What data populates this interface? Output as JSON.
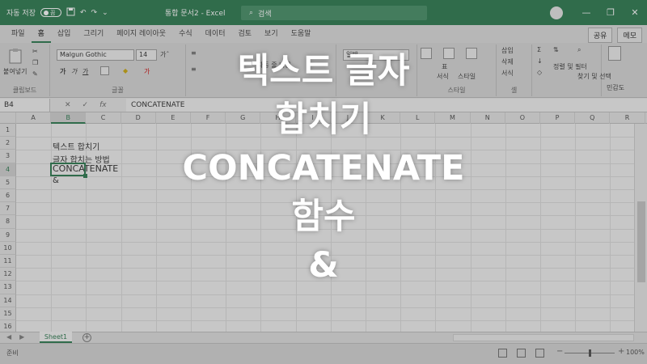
{
  "colors": {
    "accent": "#217346",
    "headline": "#ffffff"
  },
  "titlebar": {
    "autosave_label": "자동 저장",
    "autosave_state": "끔",
    "doc_title": "통합 문서2 - Excel",
    "search_placeholder": "검색",
    "icons": [
      "save-icon",
      "undo-icon",
      "redo-icon",
      "search-icon",
      "minimize-icon",
      "maximize-icon",
      "close-icon"
    ]
  },
  "ribbon_tabs": [
    "파일",
    "홈",
    "삽입",
    "그리기",
    "페이지 레이아웃",
    "수식",
    "데이터",
    "검토",
    "보기",
    "도움말"
  ],
  "active_tab": "홈",
  "share_label": "공유",
  "comment_label": "메모",
  "ribbon": {
    "clipboard": {
      "paste_label": "붙여넣기",
      "group_label": "클립보드"
    },
    "font": {
      "name": "Malgun Gothic",
      "size": "14",
      "bold": "가",
      "italic": "가",
      "underline": "가",
      "group_label": "글꼴"
    },
    "alignment": {
      "wrap_text": "자동 줄 바꿈"
    },
    "number": {
      "format": "일반"
    },
    "styles": {
      "table_label": "표",
      "format_label": "서식",
      "cell_style_label": "스타일",
      "group_label": "스타일"
    },
    "cells": {
      "insert_label": "삽입",
      "delete_label": "삭제",
      "format_label": "서식",
      "group_label": "셀"
    },
    "editing": {
      "sort_label": "정렬 및 필터",
      "find_label": "찾기 및 선택",
      "group_label": "편집"
    },
    "sensitivity": {
      "label": "민감도"
    }
  },
  "formula_bar": {
    "name_box": "B4",
    "cancel": "✕",
    "enter": "✓",
    "fx": "fx",
    "content": "CONCATENATE"
  },
  "columns": [
    "A",
    "B",
    "C",
    "D",
    "E",
    "F",
    "G",
    "H",
    "I",
    "J",
    "K",
    "L",
    "M",
    "N",
    "O",
    "P",
    "Q",
    "R"
  ],
  "selected_column": "B",
  "rows": [
    "1",
    "2",
    "3",
    "4",
    "5",
    "6",
    "7",
    "8",
    "9",
    "10",
    "11",
    "12",
    "13",
    "14",
    "15",
    "16"
  ],
  "selected_row": "4",
  "cells": [
    {
      "ref": "B2",
      "text": "텍스트 합치기"
    },
    {
      "ref": "B3",
      "text": "글자 합치는 방법"
    },
    {
      "ref": "B4",
      "text": "CONCATENATE"
    },
    {
      "ref": "B5",
      "text": "&"
    }
  ],
  "sheet_tabs": {
    "active": "Sheet1",
    "add": "+"
  },
  "status": {
    "ready": "준비",
    "zoom_percent": 100
  },
  "headline": [
    "텍스트 글자",
    "합치기",
    "CONCATENATE",
    "함수",
    "&"
  ]
}
